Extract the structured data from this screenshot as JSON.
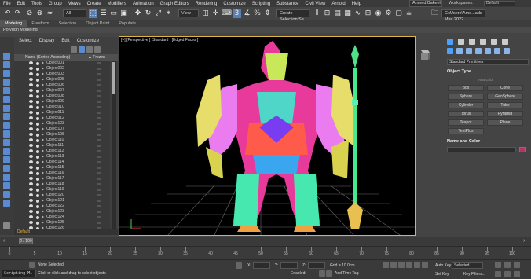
{
  "menubar": {
    "items": [
      "File",
      "Edit",
      "Tools",
      "Group",
      "Views",
      "Create",
      "Modifiers",
      "Animation",
      "Graph Editors",
      "Rendering",
      "Customize",
      "Scripting",
      "Substance",
      "Civil View",
      "Arnold",
      "Help"
    ],
    "user": "Ahmed Bakeel",
    "workspaces_label": "Workspaces:",
    "workspace": "Default"
  },
  "toolbar": {
    "selection_filter": "All",
    "view_dropdown": "View",
    "selection_set": "Create Selection Se",
    "project_path": "C:\\Users\\Ame...ads Max 2022"
  },
  "ribbon": {
    "tabs": [
      "Modeling",
      "Freeform",
      "Selection",
      "Object Paint",
      "Populate"
    ],
    "active_tab": "Modeling",
    "sub_label": "Polygon Modeling"
  },
  "explorer": {
    "menu": [
      "Select",
      "Display",
      "Edit",
      "Customize"
    ],
    "col_name": "Name (Sorted Ascending)",
    "col_frozen": "▲ Frozen",
    "rows": [
      "Object001",
      "Object002",
      "Object003",
      "Object005",
      "Object006",
      "Object007",
      "Object008",
      "Object009",
      "Object010",
      "Object011",
      "Object012",
      "Object103",
      "Object107",
      "Object108",
      "Object110",
      "Object111",
      "Object112",
      "Object113",
      "Object114",
      "Object115",
      "Object116",
      "Object117",
      "Object118",
      "Object119",
      "Object120",
      "Object121",
      "Object122",
      "Object123",
      "Object124",
      "Object125",
      "Object126",
      "Object127",
      "Object128"
    ],
    "footer": "Default"
  },
  "viewport": {
    "label": "[+] [Perspective ] [Standard ] [Edged Faces ]"
  },
  "cmdpanel": {
    "dropdown": "Standard Primitives",
    "object_type_title": "Object Type",
    "autogrid": "AutoGrid",
    "buttons": [
      "Box",
      "Cone",
      "Sphere",
      "GeoSphere",
      "Cylinder",
      "Tube",
      "Torus",
      "Pyramid",
      "Teapot",
      "Plane",
      "TextPlus"
    ],
    "name_color_title": "Name and Color",
    "colors": {
      "swatch": "#b8336a",
      "accent": "#4ea0ff"
    }
  },
  "timeline": {
    "frame": "0 / 100",
    "ticks": [
      "0",
      "5",
      "10",
      "15",
      "20",
      "25",
      "30",
      "35",
      "40",
      "45",
      "50",
      "55",
      "60",
      "65",
      "70",
      "75",
      "80",
      "85",
      "90",
      "95",
      "100"
    ]
  },
  "status": {
    "maxscript": "Scripting Mi",
    "selected": "None Selected",
    "prompt": "Click or click-and-drag to select objects",
    "x_label": "X:",
    "y_label": "Y:",
    "z_label": "Z:",
    "grid": "Grid = 10.0cm",
    "enabled": "Enabled:",
    "add_time_tag": "Add Time Tag",
    "auto_key": "Auto Key",
    "set_key": "Set Key",
    "selected_dd": "Selected",
    "key_filters": "Key Filters..."
  }
}
